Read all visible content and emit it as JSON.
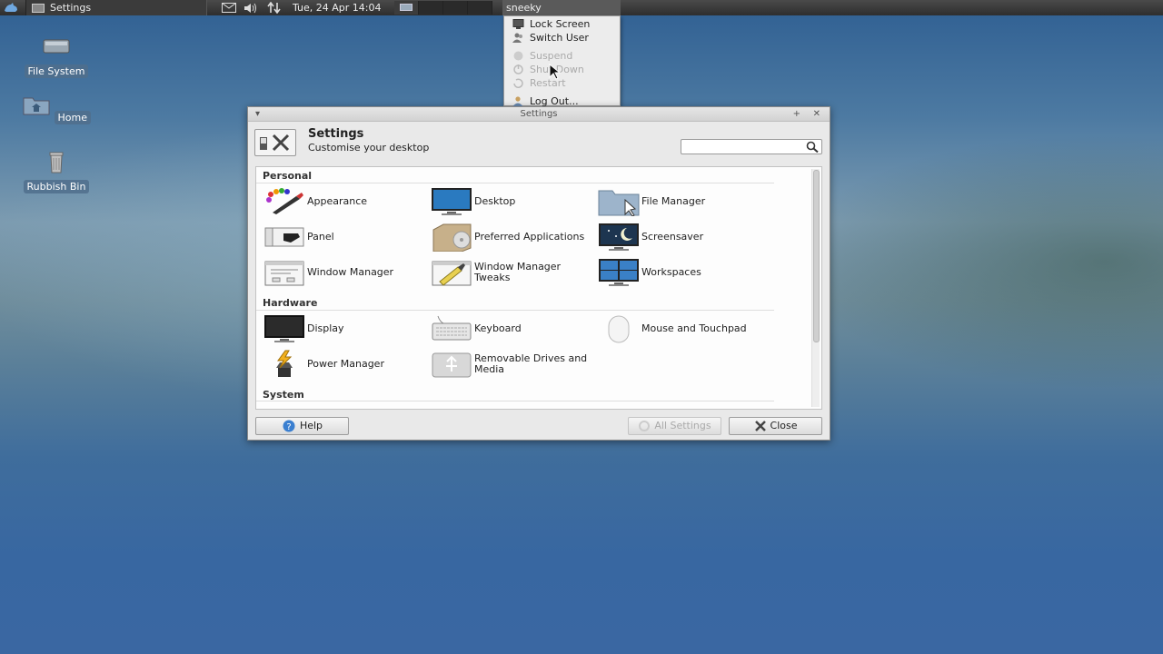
{
  "panel": {
    "task_title": "Settings",
    "clock": "Tue, 24 Apr  14:04",
    "user": "sneeky"
  },
  "user_menu": {
    "items": [
      {
        "label": "Lock Screen",
        "icon": "lock-screen-icon",
        "enabled": true
      },
      {
        "label": "Switch User",
        "icon": "switch-user-icon",
        "enabled": true
      },
      {
        "label": "Suspend",
        "icon": "suspend-icon",
        "enabled": false
      },
      {
        "label": "Shut Down",
        "icon": "shutdown-icon",
        "enabled": false
      },
      {
        "label": "Restart",
        "icon": "restart-icon",
        "enabled": false
      },
      {
        "label": "Log Out...",
        "icon": "logout-icon",
        "enabled": true
      }
    ]
  },
  "desktop": {
    "icons": [
      {
        "label": "File System",
        "icon": "drive-icon"
      },
      {
        "label": "Home",
        "icon": "home-folder-icon"
      },
      {
        "label": "Rubbish Bin",
        "icon": "trash-icon"
      }
    ]
  },
  "window": {
    "title": "Settings",
    "header_title": "Settings",
    "header_subtitle": "Customise your desktop",
    "search_placeholder": "",
    "sections": {
      "personal": {
        "title": "Personal",
        "items": [
          "Appearance",
          "Desktop",
          "File Manager",
          "Panel",
          "Preferred Applications",
          "Screensaver",
          "Window Manager",
          "Window Manager Tweaks",
          "Workspaces"
        ]
      },
      "hardware": {
        "title": "Hardware",
        "items": [
          "Display",
          "Keyboard",
          "Mouse and Touchpad",
          "Power Manager",
          "Removable Drives and Media"
        ]
      },
      "system": {
        "title": "System"
      }
    },
    "buttons": {
      "help": "Help",
      "all_settings": "All Settings",
      "close": "Close"
    }
  },
  "colors": {
    "panel_bg": "#3a3a3a",
    "window_bg": "#e9e9e9",
    "desktop_accent": "#3f6d9c"
  }
}
